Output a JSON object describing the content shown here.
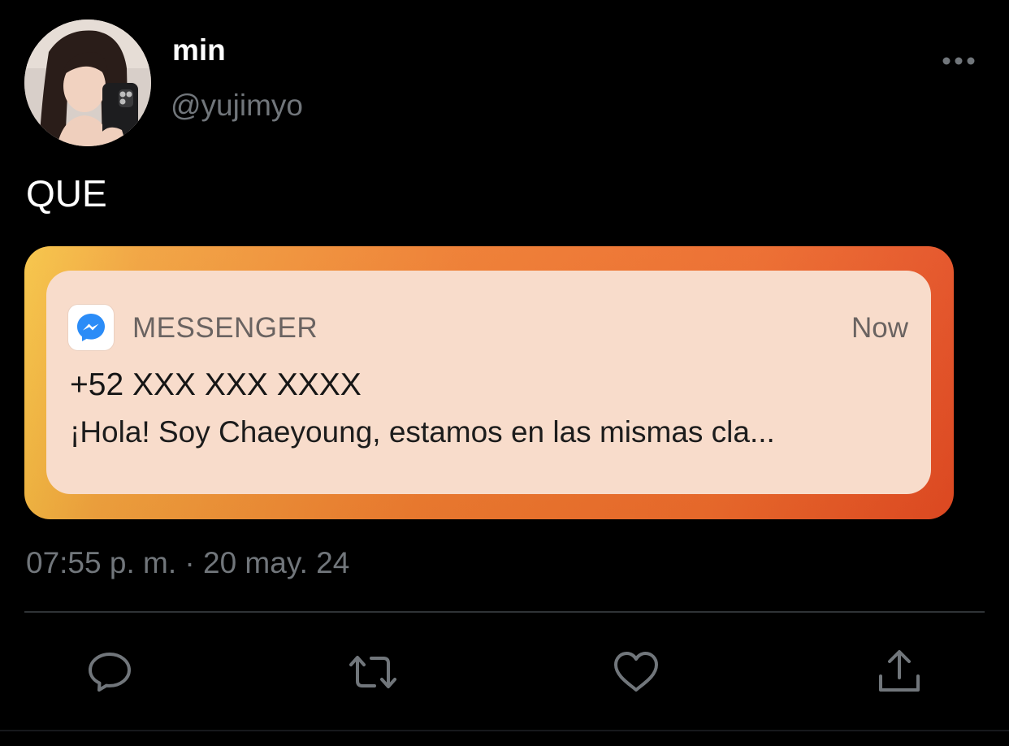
{
  "tweet": {
    "display_name": "min",
    "handle": "@yujimyo",
    "text": "QUE",
    "timestamp": "07:55 p. m. · 20 may. 24"
  },
  "header": {
    "avatar_icon": "profile-photo",
    "more_icon": "more-horizontal-icon"
  },
  "media": {
    "notification": {
      "app_icon": "messenger-icon",
      "app_name": "MESSENGER",
      "time": "Now",
      "title": "+52 XXX XXX XXXX",
      "body": "¡Hola! Soy Chaeyoung, estamos en las mismas cla..."
    },
    "colors": {
      "gradient_start": "#f6c445",
      "gradient_mid": "#ee7b2f",
      "gradient_end": "#e24a22",
      "card": "#f8dccb",
      "messenger_blue": "#2b8cf7"
    }
  },
  "actions": [
    {
      "icon": "reply-icon"
    },
    {
      "icon": "retweet-icon"
    },
    {
      "icon": "like-icon"
    },
    {
      "icon": "share-icon"
    }
  ],
  "colors": {
    "background": "#000000",
    "text_primary": "#ffffff",
    "text_secondary": "#71767b",
    "divider": "#2f3336"
  }
}
